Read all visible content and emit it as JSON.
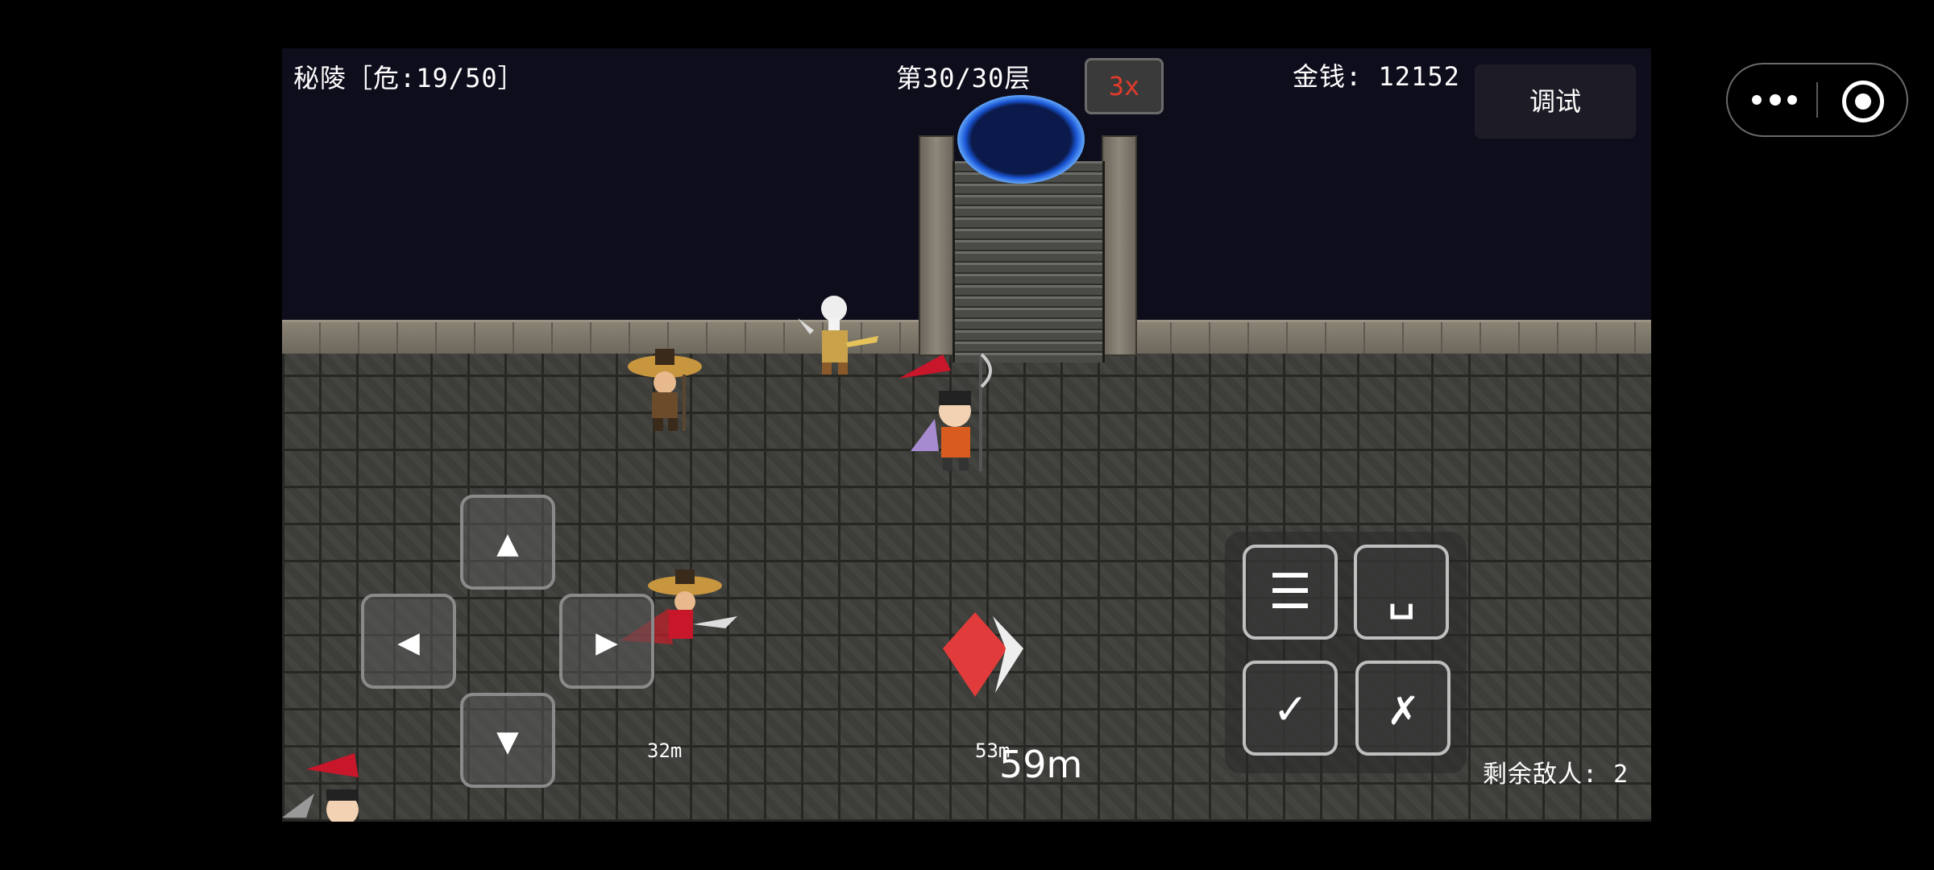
{
  "hud": {
    "location": "秘陵［危:19/50］",
    "floor": "第30/30层",
    "speed": "3x",
    "money": "金钱: 12152",
    "debug": "调试",
    "enemies_left": "剩余敌人: 2"
  },
  "controls": {
    "up": "▲",
    "down": "▼",
    "left": "◀",
    "right": "▶",
    "menu": "☰",
    "space": "␣",
    "confirm": "✓",
    "cancel": "✗"
  },
  "distances": {
    "enemy_a": "32m",
    "enemy_b": "53m",
    "target": "59m"
  },
  "colors": {
    "speed_text": "#e23b2b",
    "portal": "#1a56d6"
  }
}
